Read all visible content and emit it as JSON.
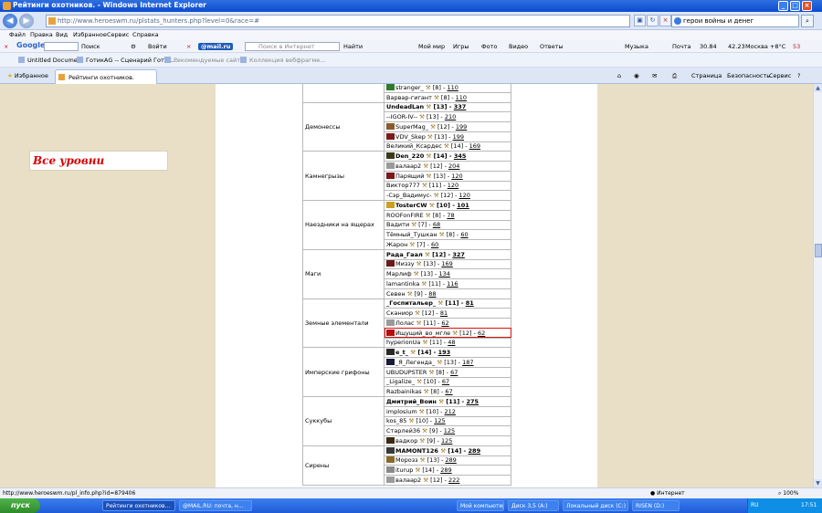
{
  "window": {
    "title": "Рейтинги охотников. - Windows Internet Explorer"
  },
  "address": {
    "url": "http://www.heroeswm.ru/plstats_hunters.php?level=0&race=#",
    "search_value": "герои войны и денег"
  },
  "menu": [
    "Файл",
    "Правка",
    "Вид",
    "Избранное",
    "Сервис",
    "Справка"
  ],
  "google_toolbar": {
    "logo": "Google",
    "search_label": "Поиск",
    "login_label": "Войти",
    "mailru": "@mail.ru",
    "search_placeholder": "Поиск в Интернет",
    "find_label": "Найти",
    "links": [
      "Мой мир",
      "Игры",
      "Фото",
      "Видео",
      "Ответы"
    ],
    "music": "Музыка",
    "mail": "Почта",
    "rate1": "30.84",
    "rate2": "42.23",
    "weather": "Москва +8°C",
    "count": "53"
  },
  "links_bar": [
    "Untitled Document",
    "ГотикАG -- Сценарий Готик...",
    "Рекомендуемые сайты",
    "Коллекция вебфрагме..."
  ],
  "tab_bar": {
    "favorites": "Избранное",
    "tab_title": "Рейтинги охотников.",
    "commands": [
      "Страница",
      "Безопасность",
      "Сервис"
    ]
  },
  "page": {
    "level_title": "Все уровни"
  },
  "rankings": [
    {
      "group": "",
      "entries": [
        {
          "name": "stranger_",
          "level": "[8]",
          "score": "110",
          "clan": "#2f7a2f",
          "lead": false
        },
        {
          "name": "Варвар-гигант",
          "level": "[8]",
          "score": "110",
          "clan": "",
          "lead": false
        }
      ]
    },
    {
      "group": "Демонессы",
      "entries": [
        {
          "name": "UndeadLan",
          "level": "[13]",
          "score": "337",
          "clan": "",
          "lead": true
        },
        {
          "name": "--IGOR-IV--",
          "level": "[13]",
          "score": "210",
          "clan": "",
          "lead": false
        },
        {
          "name": "SuperMag_",
          "level": "[12]",
          "score": "199",
          "clan": "#8a5a2a",
          "lead": false
        },
        {
          "name": "VDV_Skep",
          "level": "[13]",
          "score": "199",
          "clan": "#7a1a1a",
          "lead": false
        },
        {
          "name": "Великий_Ксардес",
          "level": "[14]",
          "score": "169",
          "clan": "",
          "lead": false
        }
      ]
    },
    {
      "group": "Камнегрызы",
      "entries": [
        {
          "name": "Den_220",
          "level": "[14]",
          "score": "345",
          "clan": "#3a3a1a",
          "lead": true
        },
        {
          "name": "валаар2",
          "level": "[12]",
          "score": "204",
          "clan": "#9a9a9a",
          "lead": false
        },
        {
          "name": "Парящий",
          "level": "[13]",
          "score": "120",
          "clan": "#7a1a1a",
          "lead": false
        },
        {
          "name": "Виктор777",
          "level": "[11]",
          "score": "120",
          "clan": "",
          "lead": false
        },
        {
          "name": "-Сэр_Вадимус-",
          "level": "[12]",
          "score": "120",
          "clan": "",
          "lead": false
        }
      ]
    },
    {
      "group": "Наездники на ящерах",
      "entries": [
        {
          "name": "TosterCW",
          "level": "[10]",
          "score": "101",
          "clan": "#c9a020",
          "lead": true
        },
        {
          "name": "ROOFonFIRE",
          "level": "[8]",
          "score": "78",
          "clan": "",
          "lead": false
        },
        {
          "name": "Вадити",
          "level": "[7]",
          "score": "68",
          "clan": "",
          "lead": false
        },
        {
          "name": "Тёмный_Тушкан",
          "level": "[8]",
          "score": "60",
          "clan": "",
          "lead": false
        },
        {
          "name": "Жарон",
          "level": "[7]",
          "score": "60",
          "clan": "",
          "lead": false
        }
      ]
    },
    {
      "group": "Маги",
      "entries": [
        {
          "name": "Рада_Гаал",
          "level": "[12]",
          "score": "327",
          "clan": "",
          "lead": true
        },
        {
          "name": "Миззу",
          "level": "[13]",
          "score": "169",
          "clan": "#6a1a1a",
          "lead": false
        },
        {
          "name": "Марлиф",
          "level": "[13]",
          "score": "134",
          "clan": "",
          "lead": false
        },
        {
          "name": "lamantinka",
          "level": "[11]",
          "score": "116",
          "clan": "",
          "lead": false
        },
        {
          "name": "Севен",
          "level": "[9]",
          "score": "88",
          "clan": "",
          "lead": false
        }
      ]
    },
    {
      "group": "Земные элементали",
      "entries": [
        {
          "name": "_Госпитальер_",
          "level": "[11]",
          "score": "81",
          "clan": "",
          "lead": true
        },
        {
          "name": "Сканиор",
          "level": "[12]",
          "score": "81",
          "clan": "",
          "lead": false
        },
        {
          "name": "Лолас",
          "level": "[11]",
          "score": "62",
          "clan": "#9a9a9a",
          "lead": false
        },
        {
          "name": "Ищущий_во_мгле",
          "level": "[12]",
          "score": "62",
          "clan": "#b01010",
          "lead": false,
          "highlight": true
        },
        {
          "name": "hyperionUa",
          "level": "[11]",
          "score": "48",
          "clan": "",
          "lead": false
        }
      ]
    },
    {
      "group": "Имперские грифоны",
      "entries": [
        {
          "name": "e_t_",
          "level": "[14]",
          "score": "193",
          "clan": "#2a2a2a",
          "lead": true
        },
        {
          "name": "_Я_Легенда_",
          "level": "[13]",
          "score": "187",
          "clan": "#1a1a3a",
          "lead": false
        },
        {
          "name": "UBUDUPSTER",
          "level": "[8]",
          "score": "67",
          "clan": "",
          "lead": false
        },
        {
          "name": "_Ligalize_",
          "level": "[10]",
          "score": "67",
          "clan": "",
          "lead": false
        },
        {
          "name": "Razbainikas",
          "level": "[8]",
          "score": "67",
          "clan": "",
          "lead": false
        }
      ]
    },
    {
      "group": "Суккубы",
      "entries": [
        {
          "name": "Дмитрий_Воин",
          "level": "[11]",
          "score": "275",
          "clan": "",
          "lead": true
        },
        {
          "name": "implosium",
          "level": "[10]",
          "score": "212",
          "clan": "",
          "lead": false
        },
        {
          "name": "kos_85",
          "level": "[10]",
          "score": "125",
          "clan": "",
          "lead": false
        },
        {
          "name": "Старлей36",
          "level": "[9]",
          "score": "125",
          "clan": "",
          "lead": false
        },
        {
          "name": "вадкор",
          "level": "[9]",
          "score": "125",
          "clan": "#3a2a10",
          "lead": false
        }
      ]
    },
    {
      "group": "Сирены",
      "entries": [
        {
          "name": "MAMONT126",
          "level": "[14]",
          "score": "289",
          "clan": "#3a3a3a",
          "lead": true
        },
        {
          "name": "Морозз",
          "level": "[13]",
          "score": "289",
          "clan": "#8a6a2a",
          "lead": false
        },
        {
          "name": "iturup",
          "level": "[14]",
          "score": "289",
          "clan": "#8a8a8a",
          "lead": false
        },
        {
          "name": "валаар2",
          "level": "[12]",
          "score": "222",
          "clan": "#9a9a9a",
          "lead": false
        }
      ]
    }
  ],
  "status": {
    "link": "http://www.heroeswm.ru/pl_info.php?id=879406",
    "zone": "Интернет",
    "zoom": "100%"
  },
  "taskbar": {
    "start": "пуск",
    "tasks": [
      "Рейтинги охотников...",
      "@MAIL.RU: почта, н...",
      "Мой компьютер",
      "Диск 3,5 (A:)",
      "Локальный диск (C:)",
      "RISEN (D:)"
    ],
    "lang": "RU",
    "clock": "17:51"
  }
}
